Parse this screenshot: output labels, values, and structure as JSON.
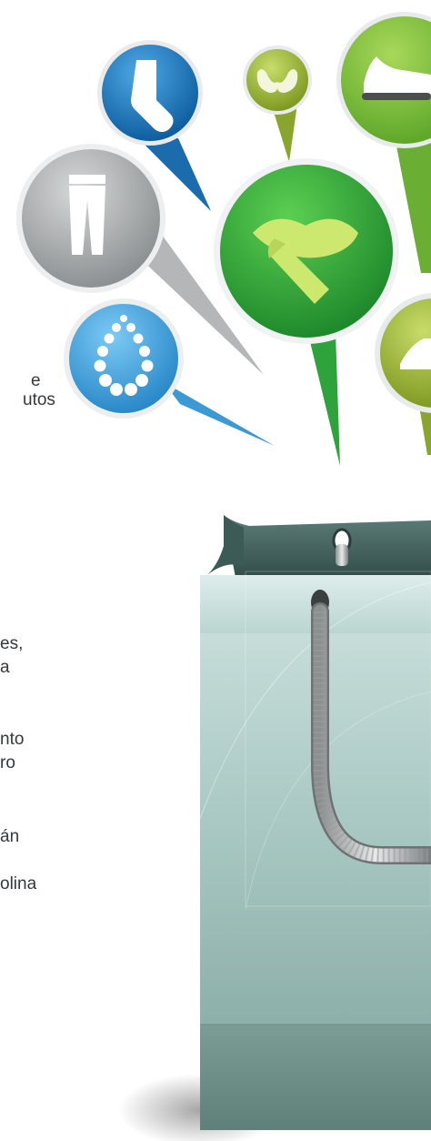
{
  "text_fragments": [
    {
      "id": "frag-1",
      "text": "e"
    },
    {
      "id": "frag-2",
      "text": "utos"
    },
    {
      "id": "frag-3",
      "text": "es,"
    },
    {
      "id": "frag-4",
      "text": "a"
    },
    {
      "id": "frag-5",
      "text": "nto"
    },
    {
      "id": "frag-6",
      "text": "ro"
    },
    {
      "id": "frag-7",
      "text": "án"
    },
    {
      "id": "frag-8",
      "text": "olina"
    }
  ],
  "pins": [
    {
      "name": "sock-pin",
      "icon": "sock-icon",
      "color": "#1f77bb"
    },
    {
      "name": "bra-pin",
      "icon": "bra-icon",
      "color": "#9ab43a"
    },
    {
      "name": "sneaker-pin",
      "icon": "sneaker-icon",
      "color": "#7bbf3c"
    },
    {
      "name": "pants-pin",
      "icon": "pants-icon",
      "color": "#a9acae"
    },
    {
      "name": "lipstick-pin",
      "icon": "lipstick-icon",
      "color": "#32a93f"
    },
    {
      "name": "necklace-pin",
      "icon": "necklace-icon",
      "color": "#3a9fd9"
    },
    {
      "name": "shoe-pin",
      "icon": "shoe-icon",
      "color": "#9ab43a"
    }
  ],
  "bag": {
    "icon": "shopping-bag-icon",
    "color": "#8fb0aa"
  }
}
